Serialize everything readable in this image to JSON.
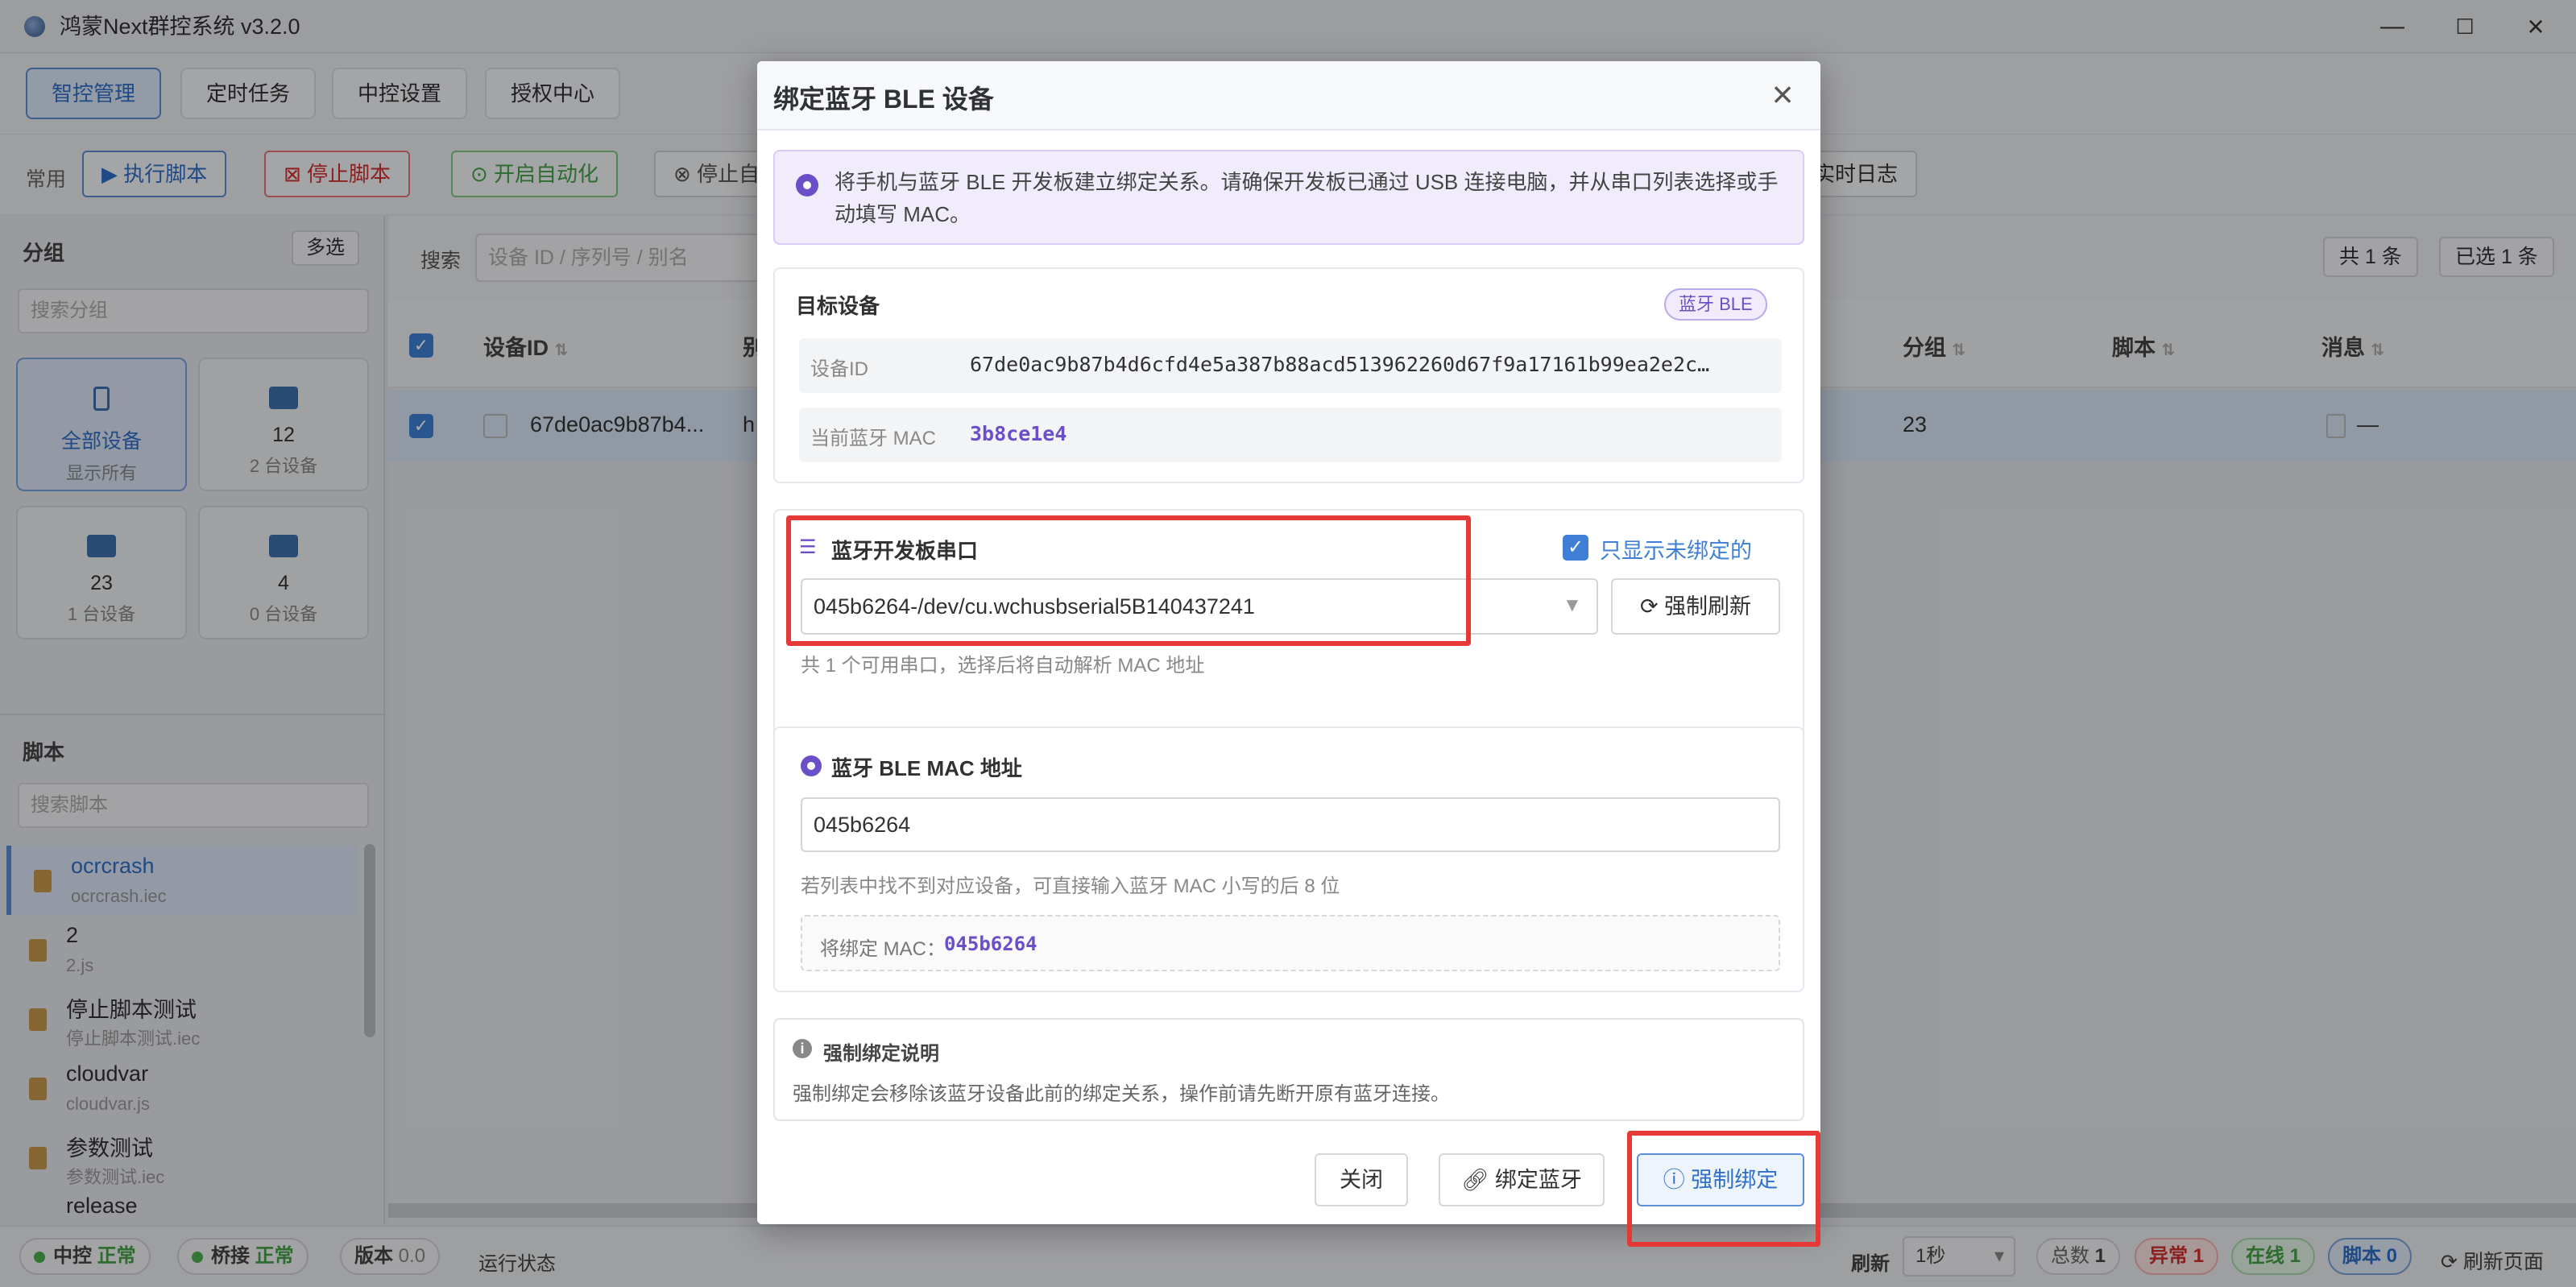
{
  "window": {
    "title": "鸿蒙Next群控系统 v3.2.0",
    "minimize": "—",
    "maximize": "☐",
    "close": "×"
  },
  "nav": {
    "tabs": [
      "智控管理",
      "定时任务",
      "中控设置",
      "授权中心"
    ]
  },
  "toolbar": {
    "label": "常用",
    "run": "执行脚本",
    "stop": "停止脚本",
    "auto": "开启自动化",
    "stop_partial": "停止自",
    "realtime_log": "实时日志"
  },
  "sidebar": {
    "group_title": "分组",
    "multi_select": "多选",
    "group_search_placeholder": "搜索分组",
    "groups": [
      {
        "name": "全部设备",
        "sub": "显示所有"
      },
      {
        "name": "12",
        "sub": "2 台设备"
      },
      {
        "name": "23",
        "sub": "1 台设备"
      },
      {
        "name": "4",
        "sub": "0 台设备"
      }
    ],
    "script_title": "脚本",
    "script_search_placeholder": "搜索脚本",
    "scripts": [
      {
        "name": "ocrcrash",
        "file": "ocrcrash.iec"
      },
      {
        "name": "2",
        "file": "2.js"
      },
      {
        "name": "停止脚本测试",
        "file": "停止脚本测试.iec"
      },
      {
        "name": "cloudvar",
        "file": "cloudvar.js"
      },
      {
        "name": "参数测试",
        "file": "参数测试.iec"
      },
      {
        "name": "release",
        "file": ""
      }
    ]
  },
  "main": {
    "search_label": "搜索",
    "search_placeholder": "设备 ID / 序列号 / 别名",
    "total": "共 1 条",
    "selected": "已选 1 条",
    "columns": {
      "device_id": "设备ID",
      "alias": "别",
      "group": "分组",
      "script": "脚本",
      "message": "消息"
    },
    "row": {
      "device_id": "67de0ac9b87b4...",
      "alias": "h",
      "group": "23",
      "script": "",
      "message": "—"
    }
  },
  "modal": {
    "title": "绑定蓝牙 BLE 设备",
    "info": "将手机与蓝牙 BLE 开发板建立绑定关系。请确保开发板已通过 USB 连接电脑，并从串口列表选择或手动填写 MAC。",
    "target": {
      "title": "目标设备",
      "badge": "蓝牙 BLE",
      "device_id_label": "设备ID",
      "device_id": "67de0ac9b87b4d6cfd4e5a387b88acd513962260d67f9a17161b99ea2e2c…",
      "mac_label": "当前蓝牙 MAC",
      "mac": "3b8ce1e4"
    },
    "serial": {
      "title": "蓝牙开发板串口",
      "only_unbound": "只显示未绑定的",
      "selected": "045b6264-/dev/cu.wchusbserial5B140437241",
      "refresh": "强制刷新",
      "hint": "共 1 个可用串口，选择后将自动解析 MAC 地址"
    },
    "mac_section": {
      "title": "蓝牙 BLE MAC 地址",
      "value": "045b6264",
      "hint": "若列表中找不到对应设备，可直接输入蓝牙 MAC 小写的后 8 位",
      "preview_label": "将绑定 MAC：",
      "preview_value": "045b6264"
    },
    "force_note": {
      "title": "强制绑定说明",
      "text": "强制绑定会移除该蓝牙设备此前的绑定关系，操作前请先断开原有蓝牙连接。"
    },
    "buttons": {
      "close": "关闭",
      "bind": "绑定蓝牙",
      "force_bind": "强制绑定"
    }
  },
  "status": {
    "center": "中控",
    "center_state": "正常",
    "bridge": "桥接",
    "bridge_state": "正常",
    "version_label": "版本",
    "version": "0.0",
    "run_state": "运行状态",
    "refresh_label": "刷新",
    "refresh_interval": "1秒",
    "total_label": "总数",
    "total": "1",
    "error_label": "异常",
    "error": "1",
    "online_label": "在线",
    "online": "1",
    "script_label": "脚本",
    "script": "0",
    "refresh_page": "刷新页面"
  },
  "colors": {
    "accent": "#2f6fc7",
    "purple": "#6a4fc9",
    "danger": "#e53935",
    "success": "#4caf50"
  }
}
